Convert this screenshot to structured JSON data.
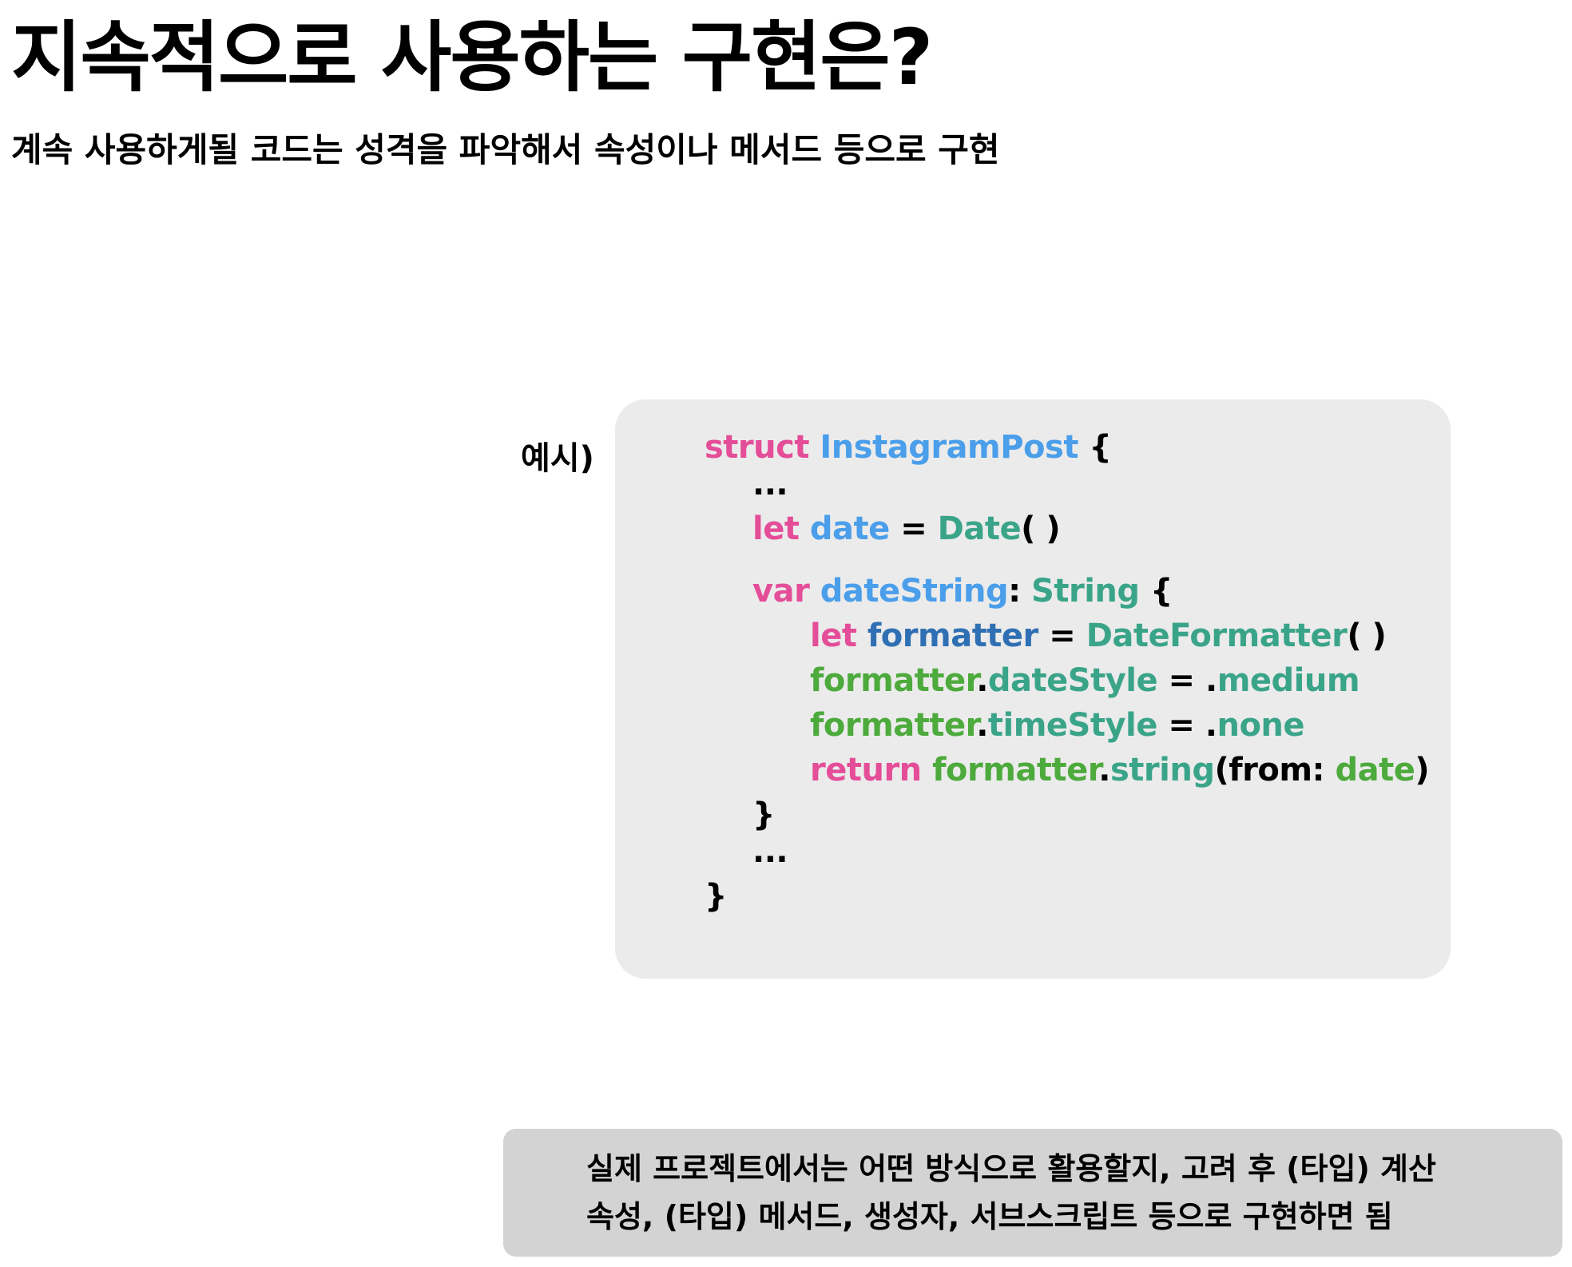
{
  "heading": {
    "title": "지속적으로 사용하는 구현은?",
    "subtitle": "계속 사용하게될 코드는 성격을 파악해서 속성이나 메서드 등으로 구현"
  },
  "example": {
    "label": "예시)",
    "code": {
      "l1": {
        "kw": "struct",
        "name": "InstagramPost",
        "brace": "{"
      },
      "l2": {
        "dots": "..."
      },
      "l3": {
        "kw": "let",
        "name": "date",
        "eq": "=",
        "type": "Date",
        "call": "( )"
      },
      "l4": {
        "kw": "var",
        "name": "dateString",
        "colon": ":",
        "type": "String",
        "brace": "{"
      },
      "l5": {
        "kw": "let",
        "name": "formatter",
        "eq": "=",
        "type": "DateFormatter",
        "call": "( )"
      },
      "l6": {
        "obj": "formatter",
        "dot": ".",
        "prop": "dateStyle",
        "eq": "=",
        "dot2": ".",
        "val": "medium"
      },
      "l7": {
        "obj": "formatter",
        "dot": ".",
        "prop": "timeStyle",
        "eq": "=",
        "dot2": ".",
        "val": "none"
      },
      "l8": {
        "kw": "return",
        "obj": "formatter",
        "dot": ".",
        "method": "string",
        "open": "(from: ",
        "arg": "date",
        "close": ")"
      },
      "l9": {
        "brace": "}"
      },
      "l10": {
        "dots": "..."
      },
      "l11": {
        "brace": "}"
      }
    }
  },
  "note": {
    "line1": "실제 프로젝트에서는 어떤 방식으로 활용할지, 고려 후 (타입) 계산",
    "line2": "속성, (타입) 메서드, 생성자, 서브스크립트 등으로 구현하면 됨"
  },
  "colors": {
    "keyword": "#e44d98",
    "type_name": "#4a9eea",
    "class_name": "#3aa489",
    "local_var": "#2f6fb3",
    "property": "#4daa3c",
    "code_box_bg": "#ebebeb",
    "note_box_bg": "#d3d3d3"
  }
}
